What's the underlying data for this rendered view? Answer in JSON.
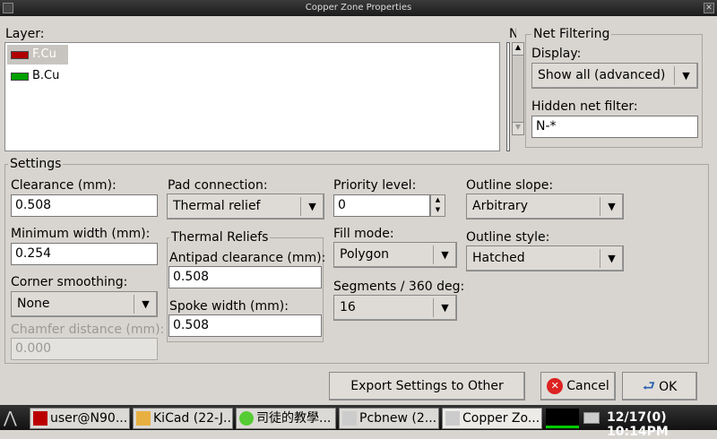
{
  "window": {
    "title": "Copper Zone Properties"
  },
  "layer": {
    "label": "Layer:",
    "items": [
      {
        "name": "F.Cu",
        "color": "#b00000",
        "selected": true
      },
      {
        "name": "B.Cu",
        "color": "#00a000",
        "selected": false
      }
    ]
  },
  "net_column_partial": "N",
  "net_filtering": {
    "title": "Net Filtering",
    "display_label": "Display:",
    "display_value": "Show all (advanced)",
    "hidden_filter_label": "Hidden net filter:",
    "hidden_filter_value": "N-*"
  },
  "settings": {
    "title": "Settings",
    "clearance_label": "Clearance (mm):",
    "clearance": "0.508",
    "min_width_label": "Minimum width (mm):",
    "min_width": "0.254",
    "corner_label": "Corner smoothing:",
    "corner": "None",
    "chamfer_label": "Chamfer distance (mm):",
    "chamfer": "0.000",
    "pad_label": "Pad connection:",
    "pad": "Thermal relief",
    "thermal_title": "Thermal Reliefs",
    "antipad_label": "Antipad clearance (mm):",
    "antipad": "0.508",
    "spoke_label": "Spoke width (mm):",
    "spoke": "0.508",
    "priority_label": "Priority level:",
    "priority": "0",
    "fill_label": "Fill mode:",
    "fill": "Polygon",
    "segments_label": "Segments / 360 deg:",
    "segments": "16",
    "slope_label": "Outline slope:",
    "slope": "Arbitrary",
    "style_label": "Outline style:",
    "style": "Hatched"
  },
  "buttons": {
    "export": "Export Settings to Other Zones",
    "cancel": "Cancel",
    "ok": "OK"
  },
  "taskbar": {
    "tasks": [
      "user@N90...",
      "KiCad (22-J...",
      "司徒的教學...",
      "Pcbnew (2...",
      "Copper Zo..."
    ],
    "clock": "12/17(0) 10:14PM"
  }
}
